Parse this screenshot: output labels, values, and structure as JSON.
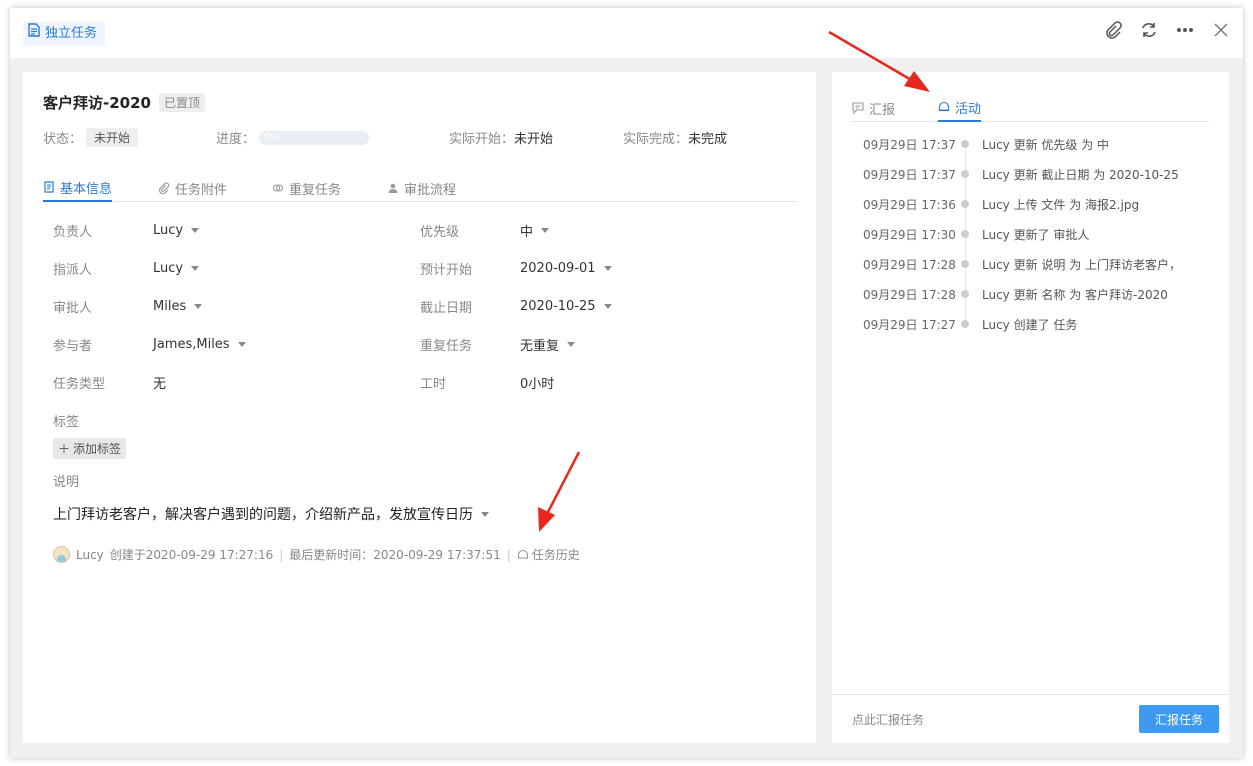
{
  "topbar": {
    "tag_label": "独立任务",
    "icons": [
      "paperclip-icon",
      "refresh-icon",
      "more-icon",
      "close-icon"
    ]
  },
  "task": {
    "title": "客户拜访-2020",
    "pinned_label": "已置顶",
    "status_label": "状态：",
    "status_value": "未开始",
    "progress_label": "进度：",
    "progress_value": "0%",
    "progress_fraction": 0,
    "actual_start_label": "实际开始：",
    "actual_start_value": "未开始",
    "actual_end_label": "实际完成：",
    "actual_end_value": "未完成"
  },
  "tabs": [
    {
      "label": "基本信息",
      "icon": "doc-icon",
      "active": true
    },
    {
      "label": "任务附件",
      "icon": "paperclip-icon",
      "active": false
    },
    {
      "label": "重复任务",
      "icon": "repeat-icon",
      "active": false
    },
    {
      "label": "审批流程",
      "icon": "user-icon",
      "active": false
    }
  ],
  "fields": {
    "owner": {
      "label": "负责人",
      "value": "Lucy"
    },
    "assigner": {
      "label": "指派人",
      "value": "Lucy"
    },
    "approver": {
      "label": "审批人",
      "value": "Miles"
    },
    "participants": {
      "label": "参与者",
      "value": "James,Miles"
    },
    "task_type": {
      "label": "任务类型",
      "value": "无"
    },
    "priority": {
      "label": "优先级",
      "value": "中"
    },
    "planned_start": {
      "label": "预计开始",
      "value": "2020-09-01"
    },
    "deadline": {
      "label": "截止日期",
      "value": "2020-10-25"
    },
    "repeat": {
      "label": "重复任务",
      "value": "无重复"
    },
    "hours": {
      "label": "工时",
      "value": "0小时"
    },
    "tags": {
      "label": "标签",
      "add_label": "添加标签"
    },
    "description": {
      "label": "说明",
      "value": "上门拜访老客户，解决客户遇到的问题，介绍新产品，发放宣传日历"
    }
  },
  "meta": {
    "user": "Lucy",
    "created": "创建于2020-09-29 17:27:16",
    "updated": "最后更新时间：2020-09-29 17:37:51",
    "history_label": "任务历史"
  },
  "right": {
    "tabs": [
      {
        "label": "汇报",
        "icon": "comment-icon",
        "active": false
      },
      {
        "label": "活动",
        "icon": "activity-icon",
        "active": true
      }
    ],
    "activities": [
      {
        "time": "09月29日 17:37",
        "text": "Lucy 更新 优先级 为 中"
      },
      {
        "time": "09月29日 17:37",
        "text": "Lucy 更新 截止日期 为 2020-10-25"
      },
      {
        "time": "09月29日 17:36",
        "text": "Lucy 上传 文件 为 海报2.jpg"
      },
      {
        "time": "09月29日 17:30",
        "text": "Lucy 更新了 审批人"
      },
      {
        "time": "09月29日 17:28",
        "text": "Lucy 更新 说明 为 上门拜访老客户，"
      },
      {
        "time": "09月29日 17:28",
        "text": "Lucy 更新 名称 为 客户拜访-2020"
      },
      {
        "time": "09月29日 17:27",
        "text": "Lucy 创建了 任务"
      }
    ],
    "footer_hint": "点此汇报任务",
    "report_button": "汇报任务"
  },
  "colors": {
    "accent": "#2a7bd5",
    "button": "#3c9af0",
    "arrow": "#e8281e"
  }
}
